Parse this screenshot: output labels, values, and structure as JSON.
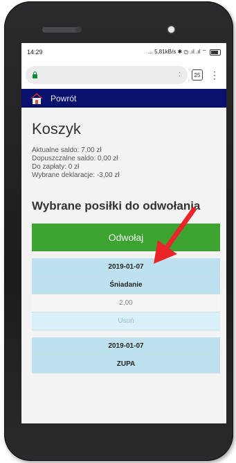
{
  "statusbar": {
    "time": "14:29",
    "indicators": "... 5,81kB/s ✱ ◷ .ıl .ıl ⌔"
  },
  "browser": {
    "tabs_count": "25",
    "menu": "⋮",
    "more": ":"
  },
  "navbar": {
    "back_label": "Powrót"
  },
  "cart": {
    "title": "Koszyk",
    "lines": [
      "Aktualne saldo: 7,00 zł",
      "Dopuszczalne saldo: 0,00 zł",
      "Do zapłaty: 0 zł",
      "Wybrane deklaracje: -3,00 zł"
    ],
    "section_title": "Wybrane posiłki do odwołania",
    "cancel_button": "Odwołaj",
    "items": [
      {
        "date": "2019-01-07",
        "meal": "Śniadanie",
        "price": "2,00",
        "remove": "Usuń"
      },
      {
        "date": "2019-01-07",
        "meal": "ZUPA"
      }
    ]
  },
  "colors": {
    "navbar": "#08106e",
    "button": "#3ca230",
    "cell": "#bde1ee",
    "arrow": "#e8262a"
  }
}
